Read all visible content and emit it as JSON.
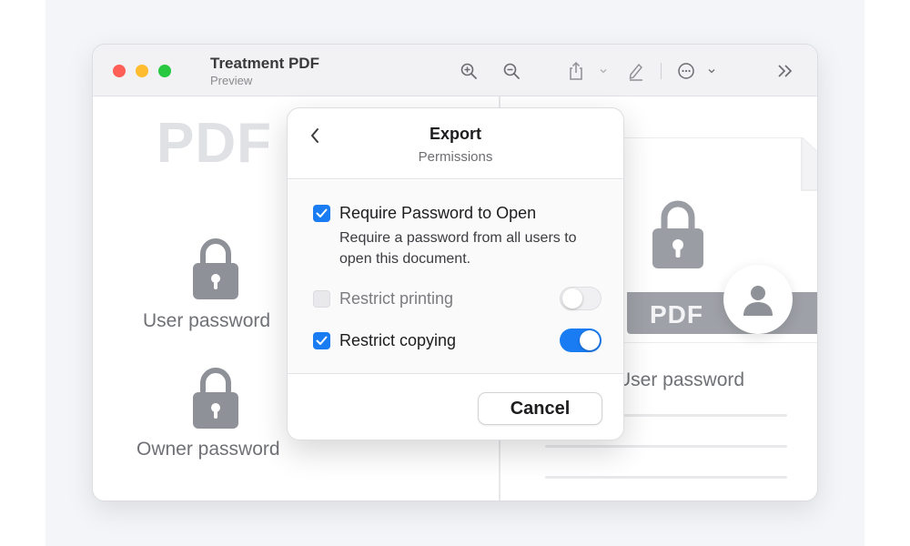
{
  "window": {
    "title": "Treatment PDF",
    "subtitle": "Preview"
  },
  "toolbar": {
    "icons": [
      "zoom-in-icon",
      "zoom-out-icon",
      "share-icon",
      "chevron-down-icon",
      "markup-pen-icon",
      "more-options-icon",
      "chevron-down-icon",
      "sidebar-expand-icon"
    ]
  },
  "background": {
    "pdf_heading": "PDF",
    "left_labels": {
      "user_password": "User password",
      "owner_password": "Owner password"
    },
    "document_badge": "PDF",
    "right_label": "User password"
  },
  "sheet": {
    "title": "Export",
    "subtitle": "Permissions",
    "options": {
      "require_password": {
        "label": "Require Password to Open",
        "description": "Require a password from all users to open this document.",
        "checked": true
      },
      "restrict_printing": {
        "label": "Restrict printing",
        "checked": false,
        "enabled": false,
        "toggle_on": false
      },
      "restrict_copying": {
        "label": "Restrict copying",
        "checked": true,
        "toggle_on": true
      }
    },
    "cancel_label": "Cancel"
  },
  "colors": {
    "accent": "#1a7cf2",
    "traffic_red": "#ff5f57",
    "traffic_yellow": "#febc2e",
    "traffic_green": "#28c840"
  }
}
